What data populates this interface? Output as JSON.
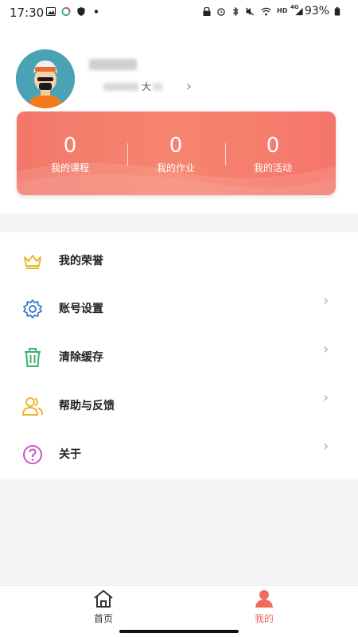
{
  "status_bar": {
    "time": "17:30",
    "battery": "93%",
    "network": "4G",
    "hd": "HD"
  },
  "profile": {
    "sub_text": "大"
  },
  "stats": [
    {
      "value": "0",
      "label": "我的课程"
    },
    {
      "value": "0",
      "label": "我的作业"
    },
    {
      "value": "0",
      "label": "我的活动"
    }
  ],
  "menu": [
    {
      "label": "我的荣誉",
      "icon": "crown-icon",
      "color": "#e8b82a",
      "chevron": false
    },
    {
      "label": "账号设置",
      "icon": "gear-icon",
      "color": "#3c7fc4",
      "chevron": true
    },
    {
      "label": "清除缓存",
      "icon": "trash-icon",
      "color": "#3ab36b",
      "chevron": true
    },
    {
      "label": "帮助与反馈",
      "icon": "users-icon",
      "color": "#f0b429",
      "chevron": true
    },
    {
      "label": "关于",
      "icon": "question-icon",
      "color": "#c25bc3",
      "chevron": true
    }
  ],
  "bottom_nav": [
    {
      "label": "首页",
      "icon": "home-icon",
      "active": false
    },
    {
      "label": "我的",
      "icon": "profile-icon",
      "active": true
    }
  ],
  "colors": {
    "accent": "#f06a5e",
    "card": "#f6806e"
  }
}
